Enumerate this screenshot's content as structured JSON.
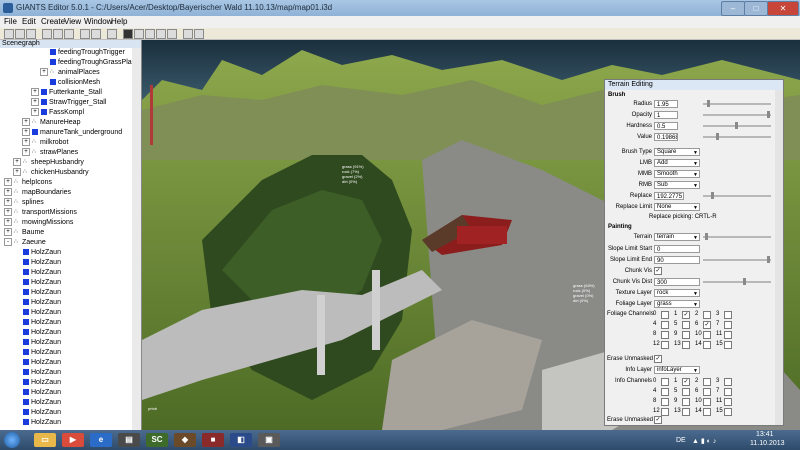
{
  "window": {
    "title": "GIANTS Editor 5.0.1 - C:/Users/Acer/Desktop/Bayerischer Wald 11.10.13/map/map01.i3d"
  },
  "menu": [
    "File",
    "Edit",
    "Create",
    "View",
    "Window",
    "Help"
  ],
  "scenegraph": {
    "title": "Scenegraph",
    "items": [
      {
        "label": "feedingTroughTrigger",
        "depth": 4,
        "icon": "cube"
      },
      {
        "label": "feedingTroughGrassPlane",
        "depth": 4,
        "icon": "cube"
      },
      {
        "label": "animalPlaces",
        "depth": 4,
        "icon": "group",
        "exp": "+"
      },
      {
        "label": "collisionMesh",
        "depth": 4,
        "icon": "cube"
      },
      {
        "label": "Futterkante_Stall",
        "depth": 3,
        "icon": "cube",
        "exp": "+"
      },
      {
        "label": "StrawTrigger_Stall",
        "depth": 3,
        "icon": "cube",
        "exp": "+"
      },
      {
        "label": "FassKompl",
        "depth": 3,
        "icon": "cube",
        "exp": "+"
      },
      {
        "label": "ManureHeap",
        "depth": 2,
        "icon": "group",
        "exp": "+"
      },
      {
        "label": "manureTank_underground",
        "depth": 2,
        "icon": "cube",
        "exp": "+"
      },
      {
        "label": "milkrobot",
        "depth": 2,
        "icon": "group",
        "exp": "+"
      },
      {
        "label": "strawPlanes",
        "depth": 2,
        "icon": "group",
        "exp": "+"
      },
      {
        "label": "sheepHusbandry",
        "depth": 1,
        "icon": "group",
        "exp": "+"
      },
      {
        "label": "chickenHusbandry",
        "depth": 1,
        "icon": "group",
        "exp": "+"
      },
      {
        "label": "helpIcons",
        "depth": 0,
        "icon": "group",
        "exp": "+"
      },
      {
        "label": "mapBoundaries",
        "depth": 0,
        "icon": "group",
        "exp": "+"
      },
      {
        "label": "splines",
        "depth": 0,
        "icon": "group",
        "exp": "+"
      },
      {
        "label": "transportMissions",
        "depth": 0,
        "icon": "group",
        "exp": "+"
      },
      {
        "label": "mowingMissions",
        "depth": 0,
        "icon": "group",
        "exp": "+"
      },
      {
        "label": "Baume",
        "depth": 0,
        "icon": "group",
        "exp": "+"
      },
      {
        "label": "Zaeune",
        "depth": 0,
        "icon": "group",
        "exp": "-"
      },
      {
        "label": "HolzZaun",
        "depth": 1,
        "icon": "cube"
      },
      {
        "label": "HolzZaun",
        "depth": 1,
        "icon": "cube"
      },
      {
        "label": "HolzZaun",
        "depth": 1,
        "icon": "cube"
      },
      {
        "label": "HolzZaun",
        "depth": 1,
        "icon": "cube"
      },
      {
        "label": "HolzZaun",
        "depth": 1,
        "icon": "cube"
      },
      {
        "label": "HolzZaun",
        "depth": 1,
        "icon": "cube"
      },
      {
        "label": "HolzZaun",
        "depth": 1,
        "icon": "cube"
      },
      {
        "label": "HolzZaun",
        "depth": 1,
        "icon": "cube"
      },
      {
        "label": "HolzZaun",
        "depth": 1,
        "icon": "cube"
      },
      {
        "label": "HolzZaun",
        "depth": 1,
        "icon": "cube"
      },
      {
        "label": "HolzZaun",
        "depth": 1,
        "icon": "cube"
      },
      {
        "label": "HolzZaun",
        "depth": 1,
        "icon": "cube"
      },
      {
        "label": "HolzZaun",
        "depth": 1,
        "icon": "cube"
      },
      {
        "label": "HolzZaun",
        "depth": 1,
        "icon": "cube"
      },
      {
        "label": "HolzZaun",
        "depth": 1,
        "icon": "cube"
      },
      {
        "label": "HolzZaun",
        "depth": 1,
        "icon": "cube"
      },
      {
        "label": "HolzZaun",
        "depth": 1,
        "icon": "cube"
      },
      {
        "label": "HolzZaun",
        "depth": 1,
        "icon": "cube"
      }
    ]
  },
  "terrain": {
    "title": "Terrain Editing",
    "brush": {
      "section": "Brush",
      "radius_label": "Radius",
      "radius": "1.95",
      "opacity_label": "Opacity",
      "opacity": "1",
      "hardness_label": "Hardness",
      "hardness": "0.5",
      "value_label": "Value",
      "value": "0.19868",
      "brushtype_label": "Brush Type",
      "brushtype": "Square",
      "lmb_label": "LMB",
      "lmb": "Add",
      "mmb_label": "MMB",
      "mmb": "Smooth",
      "rmb_label": "RMB",
      "rmb": "Sub",
      "replace_label": "Replace",
      "replace": "192.2775",
      "replacelimit_label": "Replace Limit",
      "replacelimit": "None",
      "replace_hint": "Replace picking: CRTL-R"
    },
    "painting": {
      "section": "Painting",
      "terrain_label": "Terrain",
      "terrain": "terrain",
      "slopestart_label": "Slope Limit Start",
      "slopestart": "0",
      "slopeend_label": "Slope Limit End",
      "slopeend": "90",
      "chunkvis_label": "Chunk Vis",
      "chunkdist_label": "Chunk Vis Dist",
      "chunkdist": "300",
      "texlayer_label": "Texture Layer",
      "texlayer": "rock",
      "foliagelayer_label": "Foliage Layer",
      "foliagelayer": "grass",
      "foliagech_label": "Foliage Channels",
      "foliage_channels": [
        "0",
        "1",
        "2",
        "3",
        "4",
        "5",
        "6",
        "7",
        "8",
        "9",
        "10",
        "11",
        "12",
        "13",
        "14",
        "15"
      ],
      "foliage_checked": [
        1,
        6
      ],
      "erase_label": "Erase Unmasked",
      "infolayer_label": "Info Layer",
      "infolayer": "infoLayer",
      "infoch_label": "Info Channels",
      "info_channels": [
        "0",
        "1",
        "2",
        "3",
        "4",
        "5",
        "6",
        "7",
        "8",
        "9",
        "10",
        "11",
        "12",
        "13",
        "14",
        "15"
      ],
      "info_checked": [
        1
      ],
      "erase2_label": "Erase Unmasked"
    }
  },
  "overlay": {
    "left": [
      "grass (91%)",
      "rock (7%)",
      "gravel (2%)",
      "dirt (0%)"
    ],
    "right": [
      "grass (64%)",
      "rock (0%)",
      "gravel (0%)",
      "dirt (0%)"
    ],
    "small": "prtnb"
  },
  "taskbar": {
    "lang": "DE",
    "time": "13:41",
    "date": "11.10.2013",
    "sc_label": "SC"
  }
}
